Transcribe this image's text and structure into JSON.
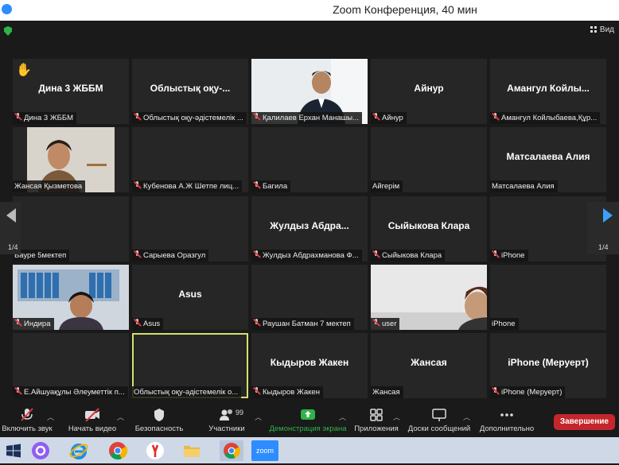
{
  "window": {
    "title": "Zoom Конференция, 40 мин"
  },
  "view_button": "Вид",
  "tiles": [
    {
      "name": "Дина 3 ЖББМ",
      "label": "Дина 3 ЖББМ",
      "big": "Дина 3 ЖББМ",
      "muted": true,
      "hand": true
    },
    {
      "name": "Облыстық оқу-...",
      "label": "Облыстық оқу-әдістемелік ...",
      "big": "Облыстық оқу-...",
      "muted": true
    },
    {
      "name": "Қалилаев Ерхан",
      "label": "Қалилаев Ерхан Манашы...",
      "big": "",
      "muted": true,
      "video": "man"
    },
    {
      "name": "Айнур",
      "label": "Айнур",
      "big": "Айнур",
      "muted": true
    },
    {
      "name": "Амангул",
      "label": "Амангул Койлыбаева,Құр...",
      "big": "Амангул Койлы...",
      "muted": true
    },
    {
      "name": "Жансая Қызметова",
      "label": "Жансая Қызметова",
      "big": "",
      "muted": false,
      "video": "woman1"
    },
    {
      "name": "Кубенова",
      "label": "Кубенова А.Ж Шетпе лиц...",
      "big": "",
      "muted": true
    },
    {
      "name": "Багила",
      "label": "Багила",
      "big": "",
      "muted": true
    },
    {
      "name": "Айгерім",
      "label": "Айгерім",
      "big": "",
      "muted": false
    },
    {
      "name": "Матсалаева Алия",
      "label": "Матсалаева Алия",
      "big": "Матсалаева Алия",
      "muted": false
    },
    {
      "name": "Бауре 5мектеп",
      "label": "Бауре 5мектеп",
      "big": "",
      "muted": false
    },
    {
      "name": "Сарыева Оразгул",
      "label": "Сарыева Оразгул",
      "big": "",
      "muted": true
    },
    {
      "name": "Жулдыз Абдрахманова",
      "label": "Жулдыз Абдрахманова Ф...",
      "big": "Жулдыз  Абдра...",
      "muted": true
    },
    {
      "name": "Сыйыкова Клара",
      "label": "Сыйыкова Клара",
      "big": "Сыйыкова Клара",
      "muted": true
    },
    {
      "name": "iPhone",
      "label": "iPhone",
      "big": "",
      "muted": true
    },
    {
      "name": "Индира",
      "label": "Индира",
      "big": "",
      "muted": true,
      "video": "woman2"
    },
    {
      "name": "Asus",
      "label": "Asus",
      "big": "Asus",
      "muted": true
    },
    {
      "name": "Раушан Батман",
      "label": "Раушан Батман 7 мектеп",
      "big": "",
      "muted": true
    },
    {
      "name": "user",
      "label": "user",
      "big": "",
      "muted": true,
      "video": "user"
    },
    {
      "name": "iPhone-2",
      "label": "iPhone",
      "big": "",
      "muted": false
    },
    {
      "name": "Е.Айшуақұлы",
      "label": "Е.Айшуақұлы Әлеуметтік п...",
      "big": "",
      "muted": true
    },
    {
      "name": "Облыстық-2",
      "label": "Облыстық оқу-әдістемелік о...",
      "big": "",
      "muted": false,
      "active": true
    },
    {
      "name": "Кыдыров Жакен",
      "label": "Кыдыров Жакен",
      "big": "Кыдыров Жакен",
      "muted": true
    },
    {
      "name": "Жансая",
      "label": "Жансая",
      "big": "Жансая",
      "muted": false
    },
    {
      "name": "iPhone (Меруерт)",
      "label": "iPhone (Меруерт)",
      "big": "iPhone (Меруерт)",
      "muted": true
    }
  ],
  "pager": {
    "left": "1/4",
    "right": "1/4"
  },
  "toolbar": {
    "mute": "Включить звук",
    "video": "Начать видео",
    "security": "Безопасность",
    "participants": "Участники",
    "participants_count": "99",
    "share": "Демонстрация экрана",
    "apps": "Приложения",
    "whiteboard": "Доски сообщений",
    "more": "Дополнительно",
    "end": "Завершение"
  },
  "taskbar_zoom": "zoom",
  "colors": {
    "accent": "#2d8cff",
    "share_green": "#2fb34a",
    "end_red": "#c4262b",
    "active_border": "#d6e06d"
  }
}
